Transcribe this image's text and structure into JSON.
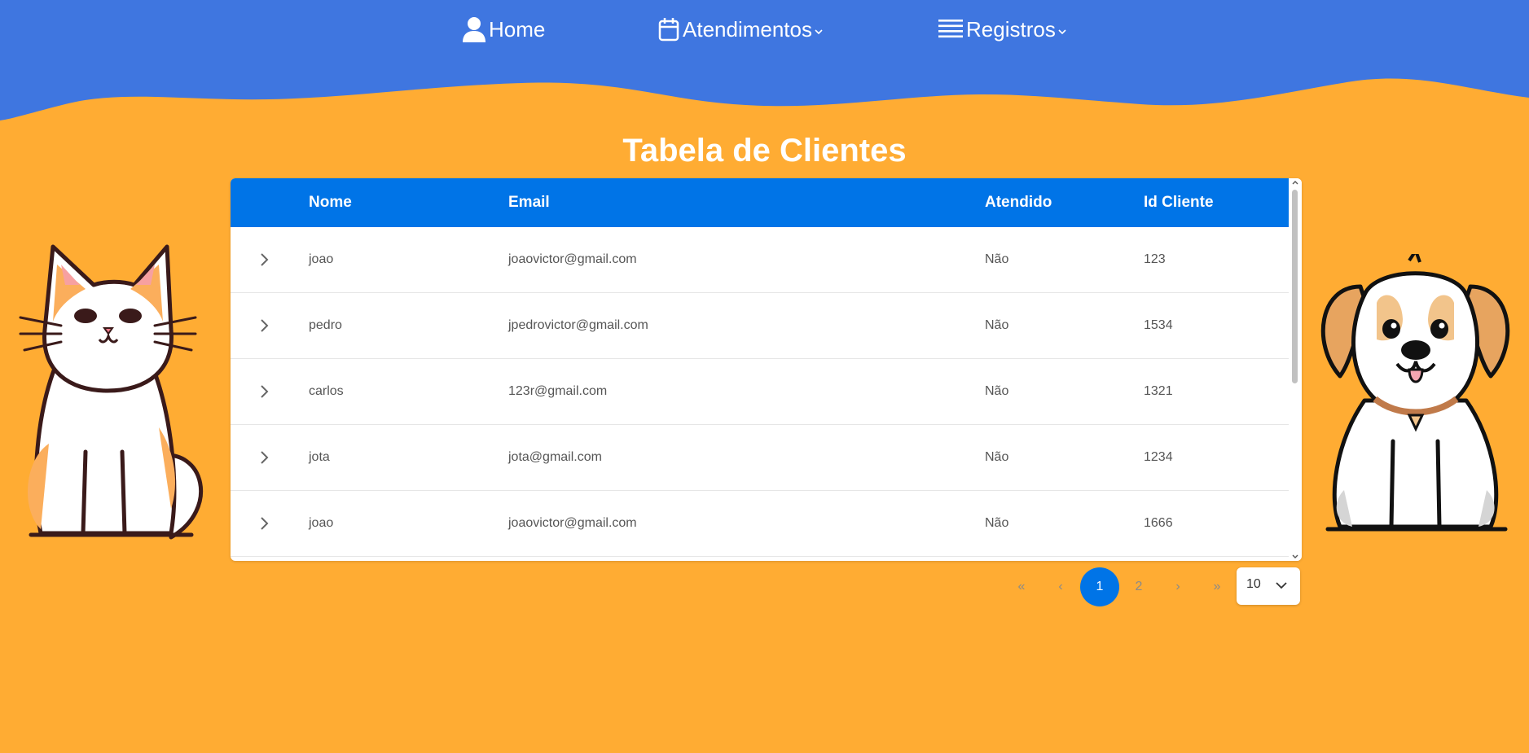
{
  "nav": {
    "home_label": "Home",
    "atendimentos_label": "Atendimentos",
    "registros_label": "Registros"
  },
  "page": {
    "title": "Tabela de Clientes"
  },
  "table": {
    "columns": [
      "Nome",
      "Email",
      "Atendido",
      "Id Cliente"
    ],
    "rows": [
      {
        "nome": "joao",
        "email": "joaovictor@gmail.com",
        "atendido": "Não",
        "id": "123"
      },
      {
        "nome": "pedro",
        "email": "jpedrovictor@gmail.com",
        "atendido": "Não",
        "id": "1534"
      },
      {
        "nome": "carlos",
        "email": "123r@gmail.com",
        "atendido": "Não",
        "id": "1321"
      },
      {
        "nome": "jota",
        "email": "jota@gmail.com",
        "atendido": "Não",
        "id": "1234"
      },
      {
        "nome": "joao",
        "email": "joaovictor@gmail.com",
        "atendido": "Não",
        "id": "1666"
      }
    ]
  },
  "pagination": {
    "first": "«",
    "prev": "‹",
    "pages": [
      "1",
      "2"
    ],
    "current": "1",
    "next": "›",
    "last": "»",
    "page_size": "10"
  },
  "colors": {
    "header": "#3F76E0",
    "background": "#FFAC33",
    "table_header": "#0074E7",
    "accent": "#0074E7"
  },
  "icons": [
    "user-icon",
    "calendar-icon",
    "list-icon",
    "chevron-down-icon",
    "chevron-right-icon",
    "cat-illustration",
    "dog-illustration"
  ]
}
